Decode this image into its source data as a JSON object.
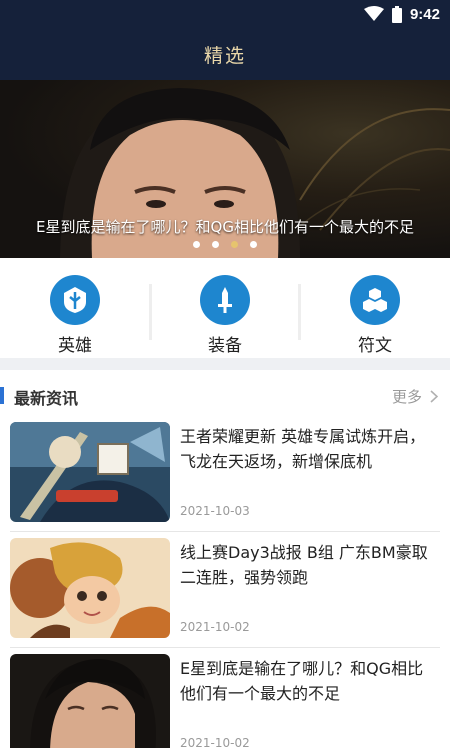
{
  "status_bar": {
    "time": "9:42"
  },
  "header": {
    "title": "精选"
  },
  "banner": {
    "caption": "E星到底是输在了哪儿？和QG相比他们有一个最大的不足",
    "dots": 4,
    "active_dot": 3
  },
  "categories": [
    {
      "label": "英雄",
      "icon": "hero-icon"
    },
    {
      "label": "装备",
      "icon": "sword-icon"
    },
    {
      "label": "符文",
      "icon": "cubes-icon"
    }
  ],
  "news_section": {
    "title": "最新资讯",
    "more": "更多"
  },
  "news": [
    {
      "title": "王者荣耀更新 英雄专属试炼开启，飞龙在天返场，新增保底机",
      "date": "2021-10-03",
      "thumb": "game-art"
    },
    {
      "title": "线上赛Day3战报 B组 广东BM豪取二连胜，强势领跑",
      "date": "2021-10-02",
      "thumb": "game-character"
    },
    {
      "title": "E星到底是输在了哪儿？和QG相比他们有一个最大的不足",
      "date": "2021-10-02",
      "thumb": "player-portrait"
    }
  ],
  "colors": {
    "header_bg": "#15213a",
    "accent_gold": "#e9d7a9",
    "icon_blue": "#1e86cf",
    "section_bar": "#2b72d4"
  }
}
